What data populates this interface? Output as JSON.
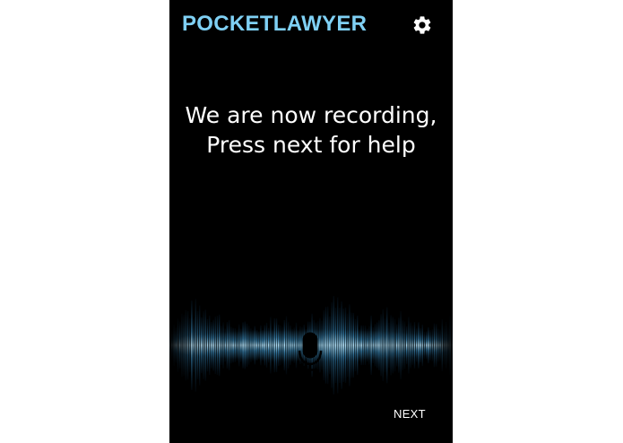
{
  "app": {
    "title": "POCKETLAWYER"
  },
  "header": {
    "settings_icon": "gear-icon"
  },
  "message": {
    "line1": "We are now recording,",
    "line2": "Press next for help"
  },
  "recording": {
    "icon": "microphone-icon",
    "waveform_color": "#6fc6f0"
  },
  "footer": {
    "next_label": "NEXT"
  },
  "colors": {
    "background": "#000000",
    "accent": "#7fd0f4",
    "text": "#ffffff"
  }
}
